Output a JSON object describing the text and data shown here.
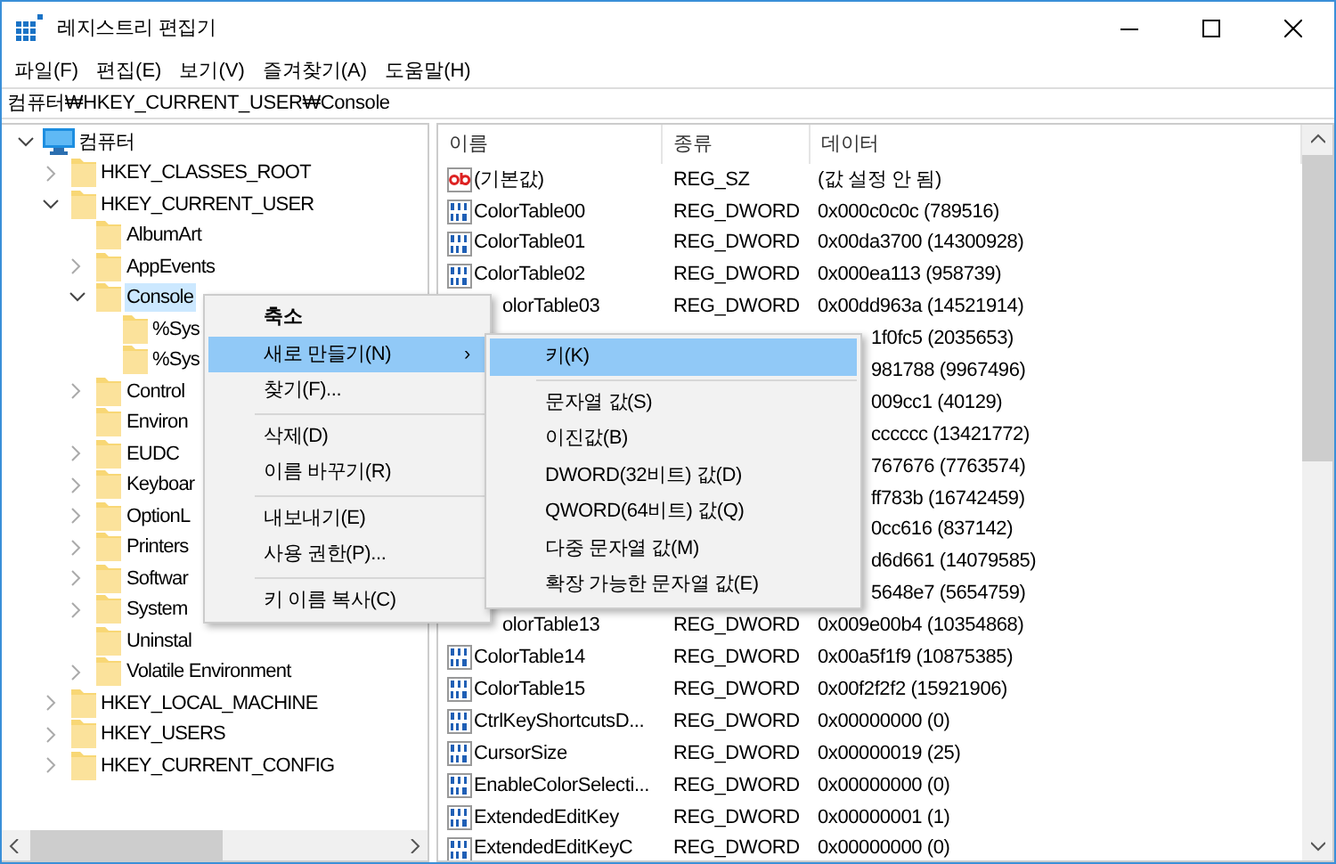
{
  "window": {
    "title": "레지스트리 편집기"
  },
  "menu_bar": [
    "파일(F)",
    "편집(E)",
    "보기(V)",
    "즐겨찾기(A)",
    "도움말(H)"
  ],
  "address": "컴퓨터₩HKEY_CURRENT_USER₩Console",
  "tree": [
    {
      "label": "컴퓨터",
      "kind": "computer",
      "expanded": true,
      "selected": false,
      "children": [
        {
          "label": "HKEY_CLASSES_ROOT",
          "kind": "folder",
          "expanded": false,
          "selected": false
        },
        {
          "label": "HKEY_CURRENT_USER",
          "kind": "folder",
          "expanded": true,
          "selected": false,
          "children": [
            {
              "label": "AlbumArt",
              "kind": "leaf",
              "selected": false
            },
            {
              "label": "AppEvents",
              "kind": "folder",
              "expanded": false,
              "selected": false
            },
            {
              "label": "Console",
              "kind": "folder",
              "expanded": true,
              "selected": true,
              "children": [
                {
                  "label": "%Sys",
                  "kind": "leaf",
                  "selected": false
                },
                {
                  "label": "%Sys",
                  "kind": "leaf",
                  "selected": false
                }
              ]
            },
            {
              "label": "Control",
              "kind": "folder",
              "expanded": false,
              "selected": false
            },
            {
              "label": "Environ",
              "kind": "leaf",
              "selected": false
            },
            {
              "label": "EUDC",
              "kind": "folder",
              "expanded": false,
              "selected": false
            },
            {
              "label": "Keyboar",
              "kind": "folder",
              "expanded": false,
              "selected": false
            },
            {
              "label": "OptionL",
              "kind": "folder",
              "expanded": false,
              "selected": false
            },
            {
              "label": "Printers",
              "kind": "folder",
              "expanded": false,
              "selected": false
            },
            {
              "label": "Softwar",
              "kind": "folder",
              "expanded": false,
              "selected": false
            },
            {
              "label": "System",
              "kind": "folder",
              "expanded": false,
              "selected": false
            },
            {
              "label": "Uninstal",
              "kind": "leaf",
              "selected": false
            },
            {
              "label": "Volatile Environment",
              "kind": "folder",
              "expanded": false,
              "selected": false
            }
          ]
        },
        {
          "label": "HKEY_LOCAL_MACHINE",
          "kind": "folder",
          "expanded": false,
          "selected": false
        },
        {
          "label": "HKEY_USERS",
          "kind": "folder",
          "expanded": false,
          "selected": false
        },
        {
          "label": "HKEY_CURRENT_CONFIG",
          "kind": "folder",
          "expanded": false,
          "selected": false
        }
      ]
    }
  ],
  "table": {
    "columns": [
      "이름",
      "종류",
      "데이터"
    ],
    "rows": [
      {
        "kind": "string",
        "name": "(기본값)",
        "type": "REG_SZ",
        "data": "(값 설정 안 됨)"
      },
      {
        "kind": "dword",
        "name": "ColorTable00",
        "type": "REG_DWORD",
        "data": "0x000c0c0c (789516)"
      },
      {
        "kind": "dword",
        "name": "ColorTable01",
        "type": "REG_DWORD",
        "data": "0x00da3700 (14300928)"
      },
      {
        "kind": "dword",
        "name": "ColorTable02",
        "type": "REG_DWORD",
        "data": "0x000ea113 (958739)"
      },
      {
        "kind": "name-cut",
        "name": "olorTable03",
        "type": "REG_DWORD",
        "data": "0x00dd963a (14521914)"
      },
      {
        "kind": "data-cut",
        "data": "1f0fc5 (2035653)"
      },
      {
        "kind": "data-cut",
        "data": "981788 (9967496)"
      },
      {
        "kind": "data-cut",
        "data": "009cc1 (40129)"
      },
      {
        "kind": "data-cut",
        "data": "cccccc (13421772)"
      },
      {
        "kind": "data-cut",
        "data": "767676 (7763574)"
      },
      {
        "kind": "data-cut",
        "data": "ff783b (16742459)"
      },
      {
        "kind": "data-cut",
        "data": "0cc616 (837142)"
      },
      {
        "kind": "data-cut",
        "data": "d6d661 (14079585)"
      },
      {
        "kind": "data-cut",
        "data": "5648e7 (5654759)"
      },
      {
        "kind": "name-cut",
        "name": "olorTable13",
        "type": "REG_DWORD",
        "data": "0x009e00b4 (10354868)"
      },
      {
        "kind": "dword",
        "name": "ColorTable14",
        "type": "REG_DWORD",
        "data": "0x00a5f1f9 (10875385)"
      },
      {
        "kind": "dword",
        "name": "ColorTable15",
        "type": "REG_DWORD",
        "data": "0x00f2f2f2 (15921906)"
      },
      {
        "kind": "dword",
        "name": "CtrlKeyShortcutsD...",
        "type": "REG_DWORD",
        "data": "0x00000000 (0)"
      },
      {
        "kind": "dword",
        "name": "CursorSize",
        "type": "REG_DWORD",
        "data": "0x00000019 (25)"
      },
      {
        "kind": "dword",
        "name": "EnableColorSelecti...",
        "type": "REG_DWORD",
        "data": "0x00000000 (0)"
      },
      {
        "kind": "dword",
        "name": "ExtendedEditKey",
        "type": "REG_DWORD",
        "data": "0x00000001 (1)"
      },
      {
        "kind": "dword",
        "name": "ExtendedEditKeyC",
        "type": "REG_DWORD",
        "data": "0x00000000 (0)"
      }
    ]
  },
  "context_menu": {
    "items": [
      {
        "kind": "default",
        "label": "축소",
        "selected": false
      },
      {
        "kind": "submenu",
        "label": "새로 만들기(N)",
        "arrow": "›",
        "selected": true
      },
      {
        "kind": "item",
        "label": "찾기(F)...",
        "selected": false
      },
      {
        "kind": "separator"
      },
      {
        "kind": "item",
        "label": "삭제(D)",
        "selected": false
      },
      {
        "kind": "item",
        "label": "이름 바꾸기(R)",
        "selected": false
      },
      {
        "kind": "separator"
      },
      {
        "kind": "item",
        "label": "내보내기(E)",
        "selected": false
      },
      {
        "kind": "item",
        "label": "사용 권한(P)...",
        "selected": false
      },
      {
        "kind": "separator"
      },
      {
        "kind": "item",
        "label": "키 이름 복사(C)",
        "selected": false
      }
    ]
  },
  "submenu": {
    "items": [
      {
        "kind": "item",
        "label": "키(K)",
        "selected": true
      },
      {
        "kind": "separator"
      },
      {
        "kind": "item",
        "label": "문자열 값(S)",
        "selected": false
      },
      {
        "kind": "item",
        "label": "이진값(B)",
        "selected": false
      },
      {
        "kind": "item",
        "label": "DWORD(32비트) 값(D)",
        "selected": false
      },
      {
        "kind": "item",
        "label": "QWORD(64비트) 값(Q)",
        "selected": false
      },
      {
        "kind": "item",
        "label": "다중 문자열 값(M)",
        "selected": false
      },
      {
        "kind": "item",
        "label": "확장 가능한 문자열 값(E)",
        "selected": false
      }
    ]
  }
}
